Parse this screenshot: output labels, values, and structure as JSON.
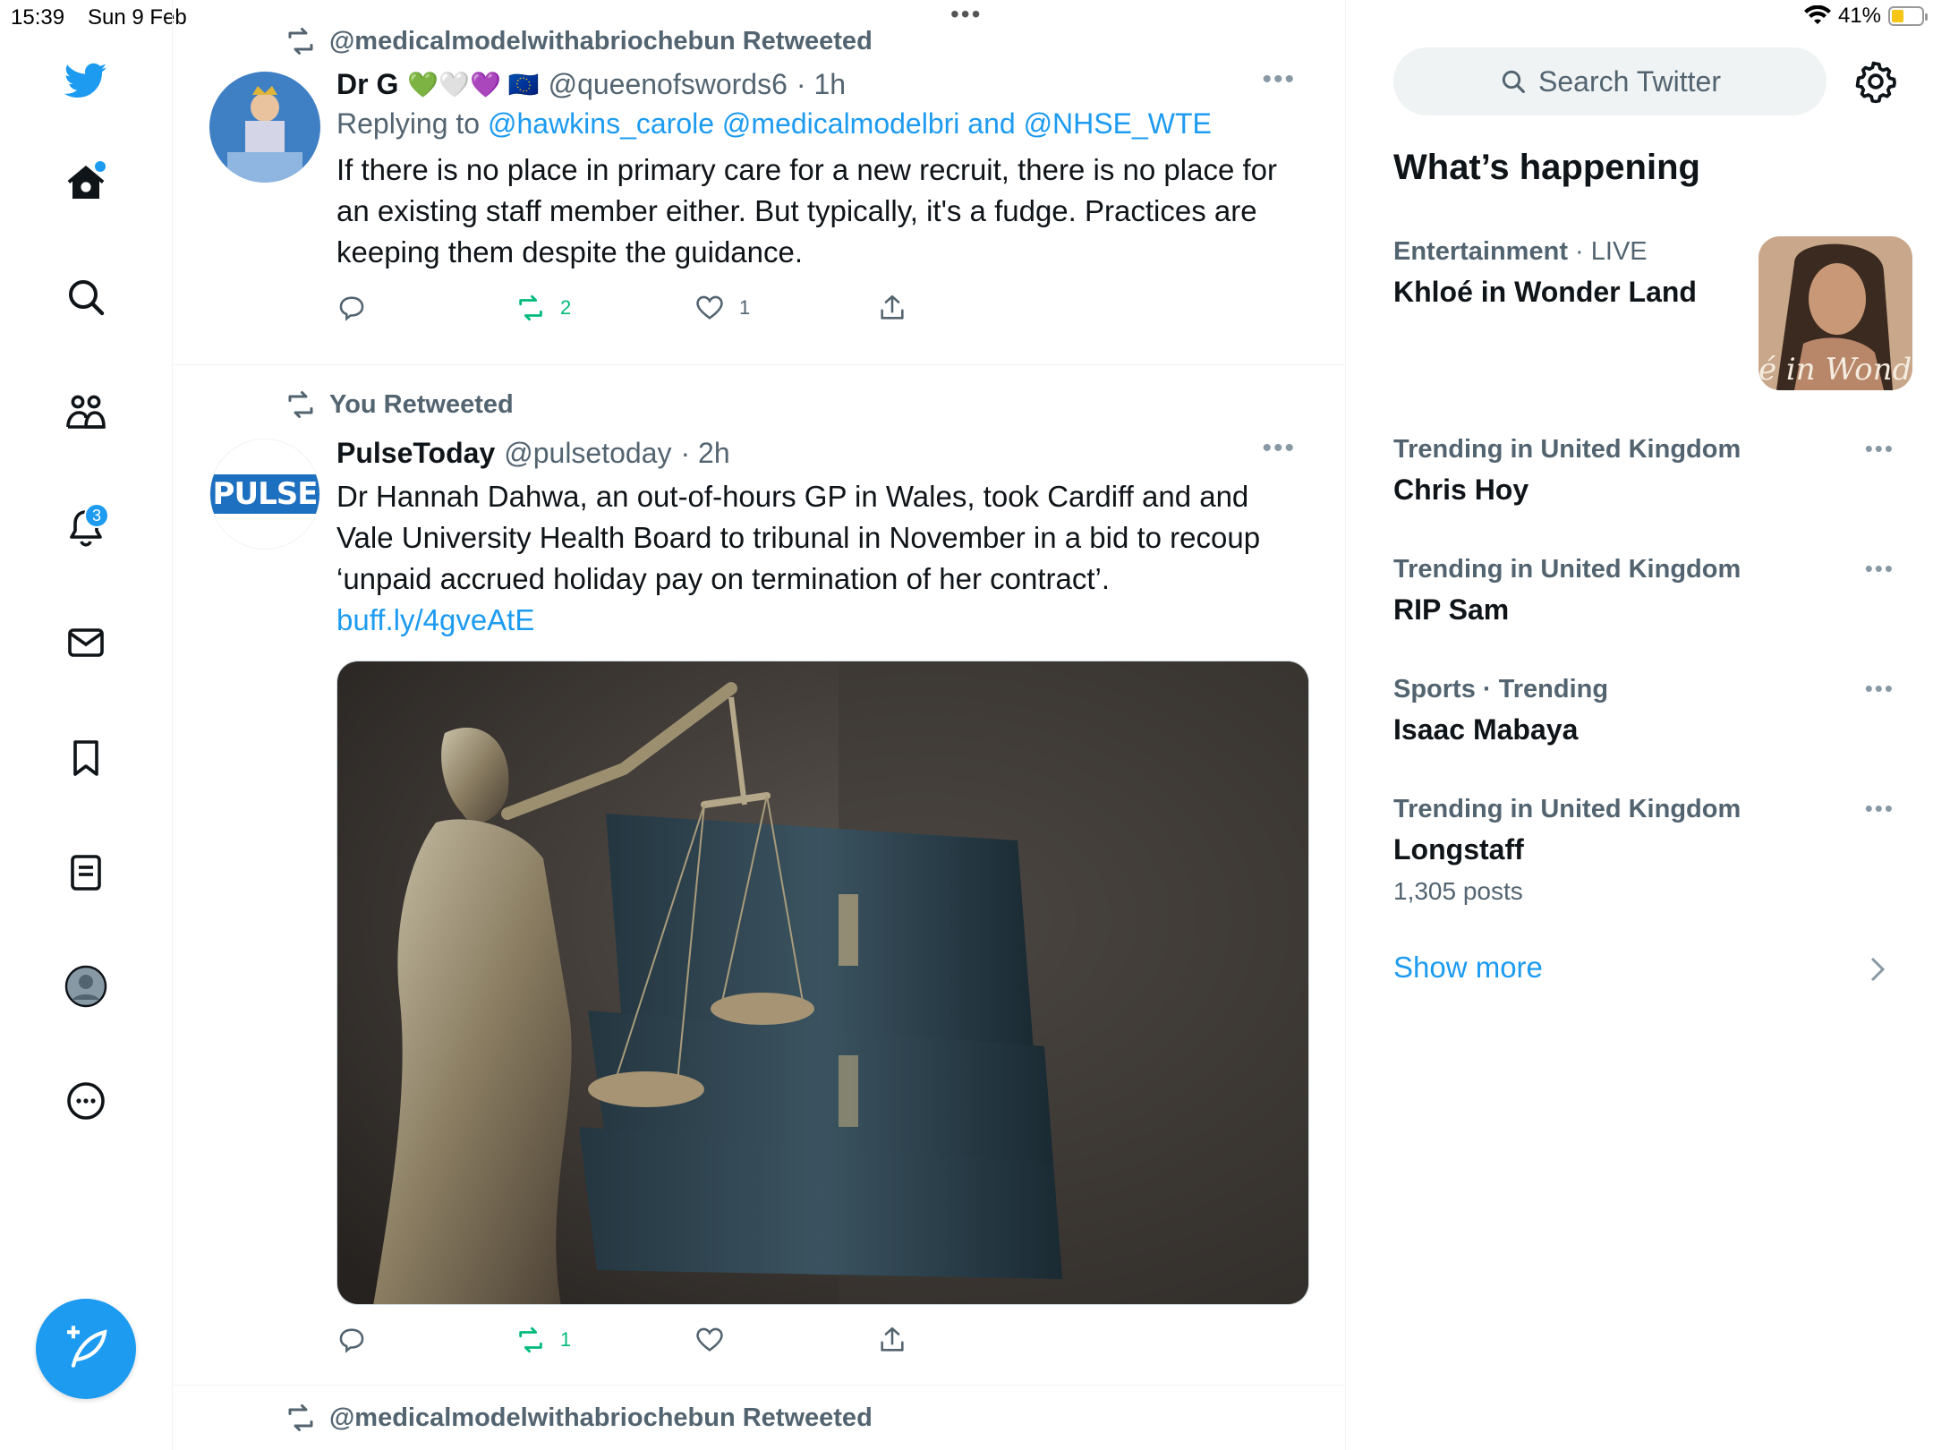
{
  "status_bar": {
    "time": "15:39",
    "date": "Sun 9 Feb",
    "battery": "41%",
    "battery_level": 0.41
  },
  "nav": {
    "notifications_badge": "3",
    "items": [
      "twitter-logo",
      "home",
      "explore",
      "communities",
      "notifications",
      "messages",
      "bookmarks",
      "lists",
      "profile",
      "more"
    ]
  },
  "tweets": [
    {
      "retweet_label": "@medicalmodelwithabriochebun Retweeted",
      "name": "Dr G",
      "emojis": "💚🤍💜 🇪🇺",
      "handle": "@queenofswords6",
      "time": "· 1h",
      "reply_prefix": "Replying to",
      "reply_to": "@hawkins_carole @medicalmodelbri and @NHSE_WTE",
      "text": "If there is no place in primary care for a new recruit, there is no place for an existing staff member either. But typically, it's a fudge. Practices are keeping them despite the guidance.",
      "retweets": "2",
      "likes": "1"
    },
    {
      "retweet_label": "You Retweeted",
      "name": "PulseToday",
      "handle": "@pulsetoday",
      "time": "· 2h",
      "avatar_text": "PULSE",
      "text": "Dr Hannah Dahwa, an out-of-hours GP in Wales, took Cardiff and and Vale University Health Board to tribunal in November in a bid to recoup ‘unpaid accrued holiday pay on termination of her contract’.",
      "link_text": "buff.ly/4gveAtE",
      "retweets": "1",
      "likes": ""
    },
    {
      "retweet_label": "@medicalmodelwithabriochebun Retweeted"
    }
  ],
  "sidebar": {
    "search_placeholder": "Search Twitter",
    "heading": "What’s happening",
    "featured": {
      "category": "Entertainment",
      "status": "· LIVE",
      "title": "Khloé in Wonder Land",
      "thumb_text": "é in Wonder L"
    },
    "trends": [
      {
        "meta": "Trending in United Kingdom",
        "title": "Chris Hoy",
        "count": ""
      },
      {
        "meta": "Trending in United Kingdom",
        "title": "RIP Sam",
        "count": ""
      },
      {
        "meta": "Sports · Trending",
        "title": "Isaac Mabaya",
        "count": ""
      },
      {
        "meta": "Trending in United Kingdom",
        "title": "Longstaff",
        "count": "1,305 posts"
      }
    ],
    "show_more": "Show more"
  },
  "colors": {
    "accent": "#1d9bf0",
    "retweet_green": "#00ba7c",
    "secondary_text": "#536471",
    "border": "#eff3f4"
  }
}
